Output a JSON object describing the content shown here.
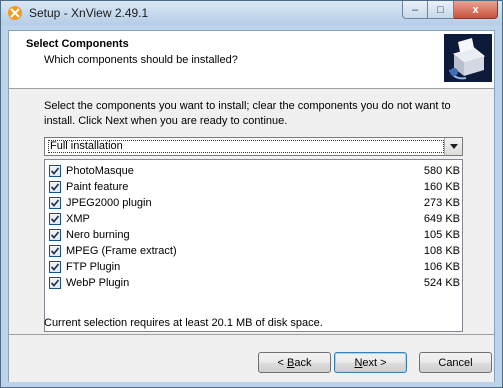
{
  "window": {
    "title": "Setup - XnView 2.49.1",
    "caption_buttons": {
      "minimize": "–",
      "maximize": "□",
      "close": "x"
    }
  },
  "header": {
    "title": "Select Components",
    "subtitle": "Which components should be installed?"
  },
  "intro_text": "Select the components you want to install; clear the components you do not want to install. Click Next when you are ready to continue.",
  "install_type": {
    "selected": "Full installation",
    "arrow_icon": "chevron-down-icon"
  },
  "components": [
    {
      "name": "PhotoMasque",
      "size": "580 KB",
      "checked": true
    },
    {
      "name": "Paint feature",
      "size": "160 KB",
      "checked": true
    },
    {
      "name": "JPEG2000 plugin",
      "size": "273 KB",
      "checked": true
    },
    {
      "name": "XMP",
      "size": "649 KB",
      "checked": true
    },
    {
      "name": "Nero burning",
      "size": "105 KB",
      "checked": true
    },
    {
      "name": "MPEG (Frame extract)",
      "size": "108 KB",
      "checked": true
    },
    {
      "name": "FTP Plugin",
      "size": "106 KB",
      "checked": true
    },
    {
      "name": "WebP Plugin",
      "size": "524 KB",
      "checked": true
    }
  ],
  "disk_space_text": "Current selection requires at least 20.1 MB of disk space.",
  "buttons": {
    "back": {
      "prefix": "< ",
      "accel": "B",
      "rest": "ack"
    },
    "next": {
      "accel": "N",
      "rest": "ext >"
    },
    "cancel": "Cancel"
  },
  "colors": {
    "title_bar": "#c9dcf0",
    "client_bg": "#f0f0f0",
    "checkbox_border": "#1c5180",
    "default_button_border": "#3c7fb1"
  }
}
